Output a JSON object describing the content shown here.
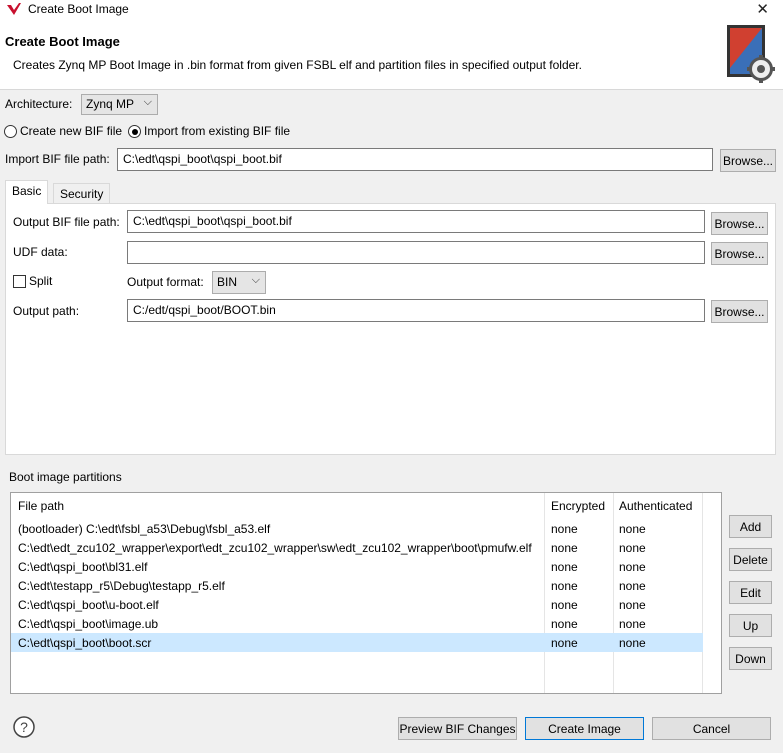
{
  "window": {
    "title": "Create Boot Image"
  },
  "header": {
    "title": "Create Boot Image",
    "description": "Creates Zynq MP Boot Image in .bin format from given FSBL elf and partition files in specified output folder."
  },
  "architecture": {
    "label": "Architecture:",
    "value": "Zynq MP"
  },
  "bif_mode": {
    "create_new_label": "Create new BIF file",
    "import_existing_label": "Import from existing BIF file",
    "selected": "import"
  },
  "import_bif": {
    "label": "Import BIF file path:",
    "value": "C:\\edt\\qspi_boot\\qspi_boot.bif",
    "browse_label": "Browse..."
  },
  "tabs": [
    {
      "label": "Basic",
      "active": true
    },
    {
      "label": "Security",
      "active": false
    }
  ],
  "basic": {
    "output_bif": {
      "label": "Output BIF file path:",
      "value": "C:\\edt\\qspi_boot\\qspi_boot.bif",
      "browse_label": "Browse..."
    },
    "udf": {
      "label": "UDF data:",
      "value": "",
      "browse_label": "Browse..."
    },
    "split": {
      "label": "Split",
      "checked": false
    },
    "output_format": {
      "label": "Output format:",
      "value": "BIN"
    },
    "output_path": {
      "label": "Output path:",
      "value": "C:/edt/qspi_boot/BOOT.bin",
      "browse_label": "Browse..."
    }
  },
  "partitions": {
    "section_label": "Boot image partitions",
    "columns": [
      "File path",
      "Encrypted",
      "Authenticated"
    ],
    "rows": [
      {
        "path": "(bootloader) C:\\edt\\fsbl_a53\\Debug\\fsbl_a53.elf",
        "encrypted": "none",
        "authenticated": "none"
      },
      {
        "path": "C:\\edt\\edt_zcu102_wrapper\\export\\edt_zcu102_wrapper\\sw\\edt_zcu102_wrapper\\boot\\pmufw.elf",
        "encrypted": "none",
        "authenticated": "none"
      },
      {
        "path": "C:\\edt\\qspi_boot\\bl31.elf",
        "encrypted": "none",
        "authenticated": "none"
      },
      {
        "path": "C:\\edt\\testapp_r5\\Debug\\testapp_r5.elf",
        "encrypted": "none",
        "authenticated": "none"
      },
      {
        "path": "C:\\edt\\qspi_boot\\u-boot.elf",
        "encrypted": "none",
        "authenticated": "none"
      },
      {
        "path": "C:\\edt\\qspi_boot\\image.ub",
        "encrypted": "none",
        "authenticated": "none"
      },
      {
        "path": "C:\\edt\\qspi_boot\\boot.scr",
        "encrypted": "none",
        "authenticated": "none",
        "selected": true
      }
    ],
    "buttons": {
      "add": "Add",
      "delete": "Delete",
      "edit": "Edit",
      "up": "Up",
      "down": "Down"
    }
  },
  "footer": {
    "help_icon": "?",
    "preview_label": "Preview BIF Changes",
    "create_label": "Create Image",
    "cancel_label": "Cancel"
  },
  "colors": {
    "selection": "#cce8ff",
    "primary_border": "#0078d7",
    "logo_red": "#c8102e"
  }
}
